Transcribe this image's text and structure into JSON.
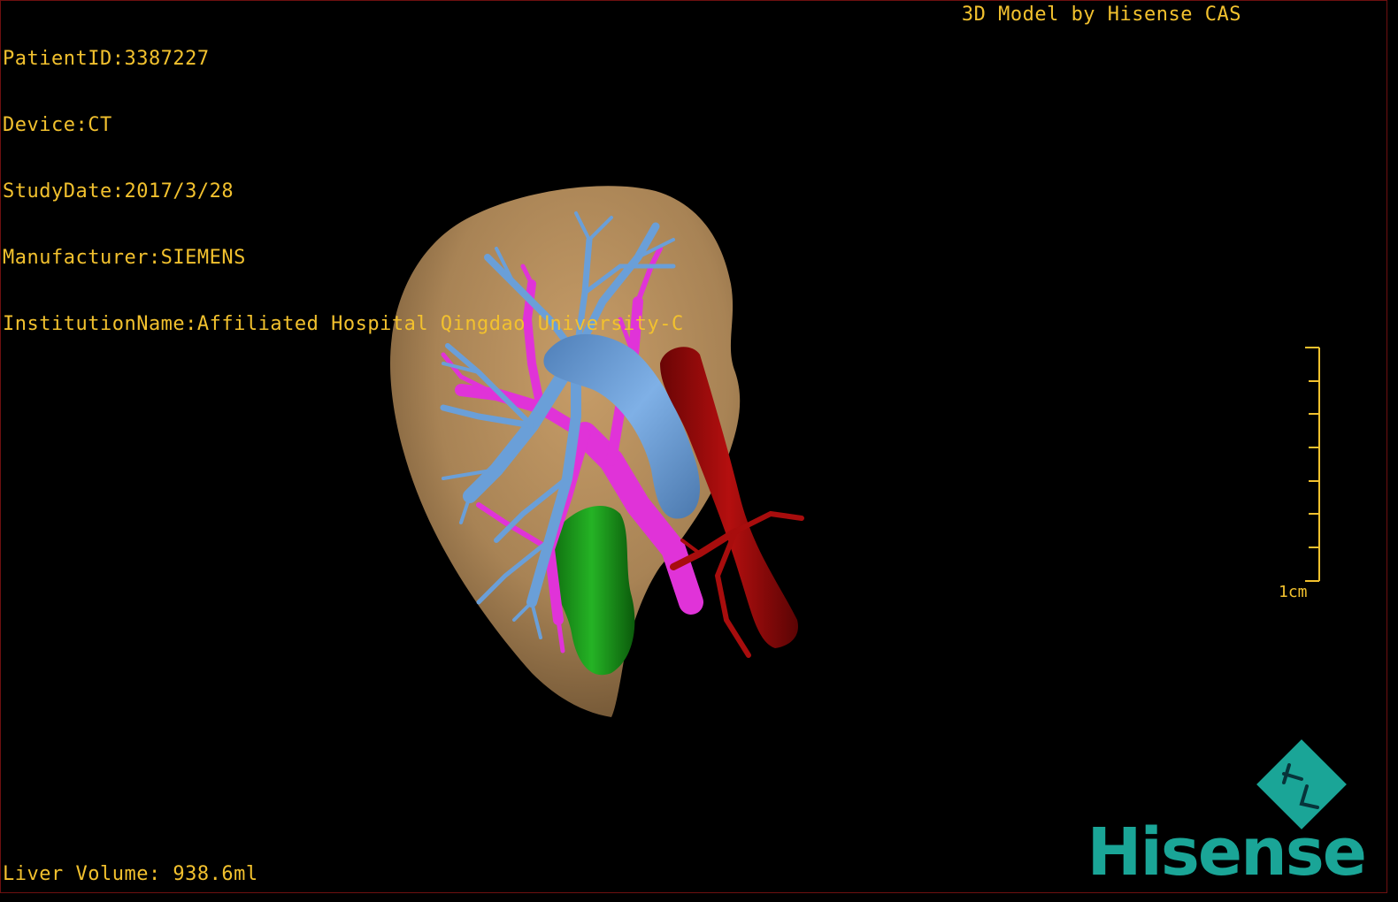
{
  "window": {
    "title": "3D Model by Hisense CAS"
  },
  "metadata": {
    "patient_id": "PatientID:3387227",
    "device": "Device:CT",
    "study_date": "StudyDate:2017/3/28",
    "manufacturer": "Manufacturer:SIEMENS",
    "institution": "InstitutionName:Affiliated Hospital Qingdao University-C"
  },
  "measurements": {
    "liver_volume": "Liver Volume: 938.6ml"
  },
  "scale_bar": {
    "label": "1cm",
    "ticks": 8
  },
  "brand": {
    "name": "Hisense",
    "color": "#1aa597"
  },
  "colors": {
    "text": "#f2c12e",
    "liver": "#b08a5a",
    "hepatic_vein": "#6a9fd8",
    "portal_vein": "#e033d8",
    "aorta": "#9e0a0a",
    "gallbladder": "#1fa31f",
    "border": "#6e1010"
  },
  "structures": [
    "liver-surface",
    "hepatic-vein-tree",
    "portal-vein-tree",
    "inferior-vena-cava",
    "aorta",
    "gallbladder"
  ]
}
